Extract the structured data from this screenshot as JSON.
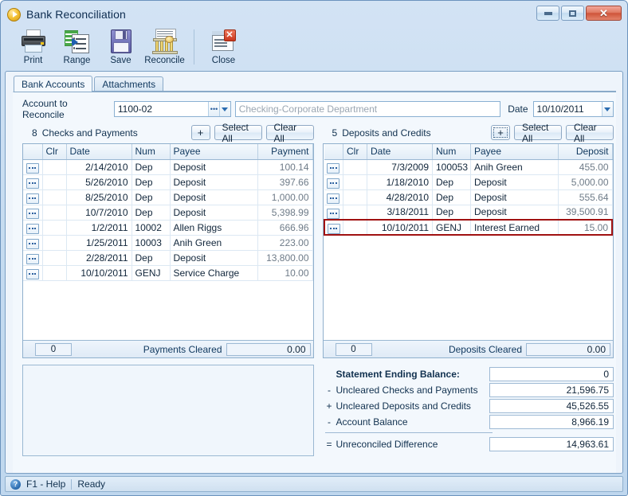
{
  "window": {
    "title": "Bank Reconciliation",
    "app_icon": "play-circle-icon",
    "controls": {
      "minimize": "minimize-icon",
      "maximize": "maximize-icon",
      "close": "✕"
    }
  },
  "toolbar": {
    "items": [
      {
        "label": "Print",
        "icon": "printer-icon"
      },
      {
        "label": "Range",
        "icon": "range-grid-icon"
      },
      {
        "label": "Save",
        "icon": "floppy-disk-icon"
      },
      {
        "label": "Reconcile",
        "icon": "bank-building-icon"
      },
      {
        "label": "Close",
        "icon": "close-window-icon"
      }
    ]
  },
  "tabs": [
    {
      "label": "Bank Accounts",
      "active": true
    },
    {
      "label": "Attachments",
      "active": false
    }
  ],
  "account_row": {
    "label": "Account to Reconcile",
    "account_value": "1100-02",
    "account_description": "Checking-Corporate Department",
    "date_label": "Date",
    "date_value": "10/10/2011"
  },
  "left_section": {
    "count": "8",
    "title": "Checks and Payments",
    "add_label": "+",
    "select_all_label": "Select All",
    "clear_all_label": "Clear All",
    "columns": [
      "",
      "Clr",
      "Date",
      "Num",
      "Payee",
      "Payment"
    ],
    "rows": [
      {
        "date": "2/14/2010",
        "num": "Dep",
        "payee": "Deposit",
        "amount": "100.14"
      },
      {
        "date": "5/26/2010",
        "num": "Dep",
        "payee": "Deposit",
        "amount": "397.66"
      },
      {
        "date": "8/25/2010",
        "num": "Dep",
        "payee": "Deposit",
        "amount": "1,000.00"
      },
      {
        "date": "10/7/2010",
        "num": "Dep",
        "payee": "Deposit",
        "amount": "5,398.99"
      },
      {
        "date": "1/2/2011",
        "num": "10002",
        "payee": "Allen Riggs",
        "amount": "666.96"
      },
      {
        "date": "1/25/2011",
        "num": "10003",
        "payee": "Anih Green",
        "amount": "223.00"
      },
      {
        "date": "2/28/2011",
        "num": "Dep",
        "payee": "Deposit",
        "amount": "13,800.00"
      },
      {
        "date": "10/10/2011",
        "num": "GENJ",
        "payee": "Service Charge",
        "amount": "10.00"
      }
    ],
    "footer": {
      "count": "0",
      "label": "Payments Cleared",
      "value": "0.00"
    }
  },
  "right_section": {
    "count": "5",
    "title": "Deposits and Credits",
    "add_label": "+",
    "select_all_label": "Select All",
    "clear_all_label": "Clear All",
    "columns": [
      "",
      "Clr",
      "Date",
      "Num",
      "Payee",
      "Deposit"
    ],
    "rows": [
      {
        "date": "7/3/2009",
        "num": "100053",
        "payee": "Anih Green",
        "amount": "455.00",
        "highlighted": false
      },
      {
        "date": "1/18/2010",
        "num": "Dep",
        "payee": "Deposit",
        "amount": "5,000.00",
        "highlighted": false
      },
      {
        "date": "4/28/2010",
        "num": "Dep",
        "payee": "Deposit",
        "amount": "555.64",
        "highlighted": false
      },
      {
        "date": "3/18/2011",
        "num": "Dep",
        "payee": "Deposit",
        "amount": "39,500.91",
        "highlighted": false
      },
      {
        "date": "10/10/2011",
        "num": "GENJ",
        "payee": "Interest Earned",
        "amount": "15.00",
        "highlighted": true
      }
    ],
    "footer": {
      "count": "0",
      "label": "Deposits Cleared",
      "value": "0.00"
    }
  },
  "summary": {
    "rows": [
      {
        "op": "",
        "label": "Statement Ending Balance:",
        "value": "0"
      },
      {
        "op": "-",
        "label": "Uncleared Checks and Payments",
        "value": "21,596.75"
      },
      {
        "op": "+",
        "label": "Uncleared Deposits and Credits",
        "value": "45,526.55"
      },
      {
        "op": "-",
        "label": "Account Balance",
        "value": "8,966.19"
      },
      {
        "op": "=",
        "label": "Unreconciled Difference",
        "value": "14,963.61"
      }
    ]
  },
  "statusbar": {
    "help_icon": "question-mark-icon",
    "help_text": "F1 - Help",
    "status_text": "Ready"
  },
  "colors": {
    "highlight_border": "#a01111",
    "title_text": "#0d2c50",
    "frame_border": "#6b93bd",
    "close_button": "#cf543a"
  }
}
